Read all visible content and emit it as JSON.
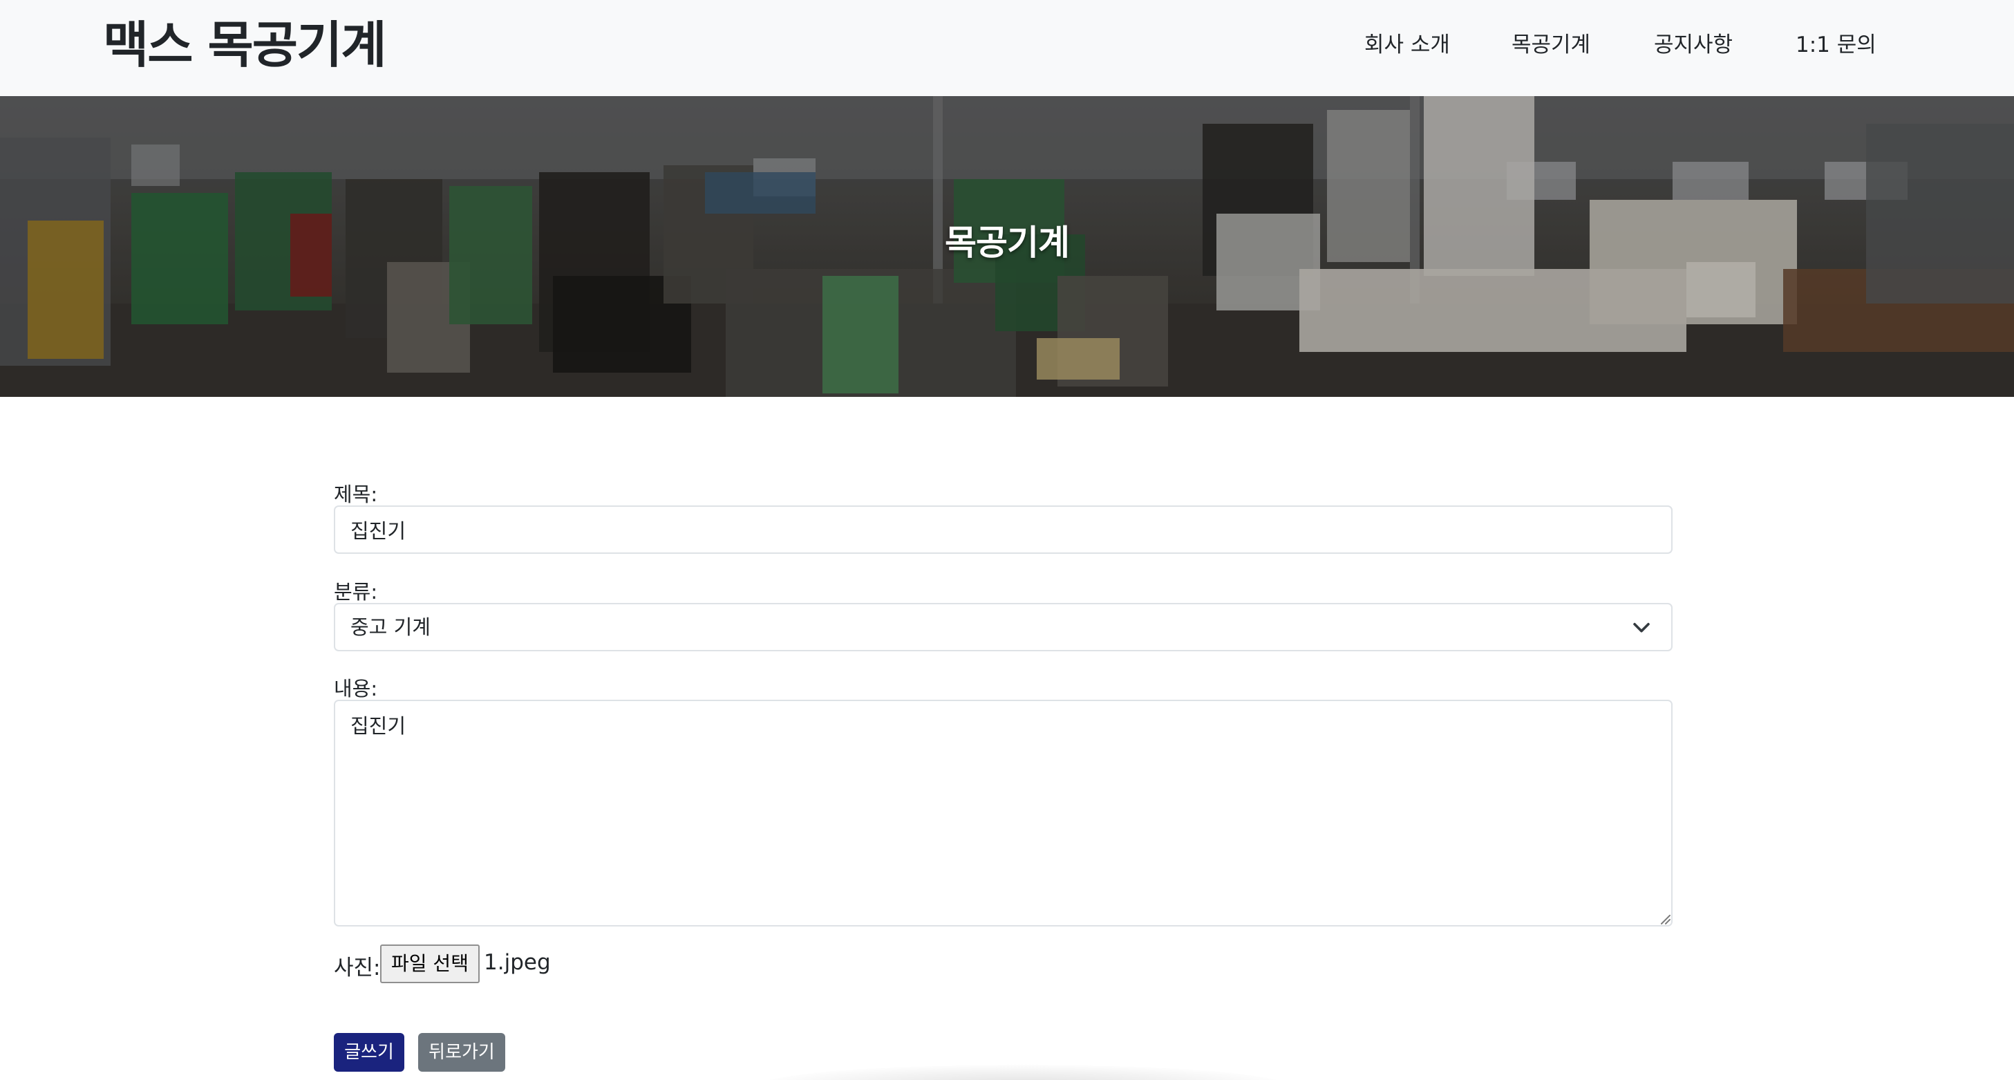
{
  "header": {
    "brand": "맥스 목공기계",
    "nav": [
      "회사 소개",
      "목공기계",
      "공지사항",
      "1:1 문의"
    ]
  },
  "hero": {
    "title": "목공기계"
  },
  "form": {
    "title_label": "제목:",
    "title_value": "집진기",
    "category_label": "분류:",
    "category_value": "중고 기계",
    "content_label": "내용:",
    "content_value": "집진기",
    "photo_label": "사진:",
    "file_button_label": "파일 선택",
    "file_name": "1.jpeg"
  },
  "buttons": {
    "submit": "글쓰기",
    "back": "뒤로가기"
  },
  "colors": {
    "navbar_bg": "#f8f9fa",
    "submit_bg": "#1a237e",
    "back_bg": "#6c757d"
  },
  "icons": {
    "select_arrow": "chevron-down-icon"
  }
}
